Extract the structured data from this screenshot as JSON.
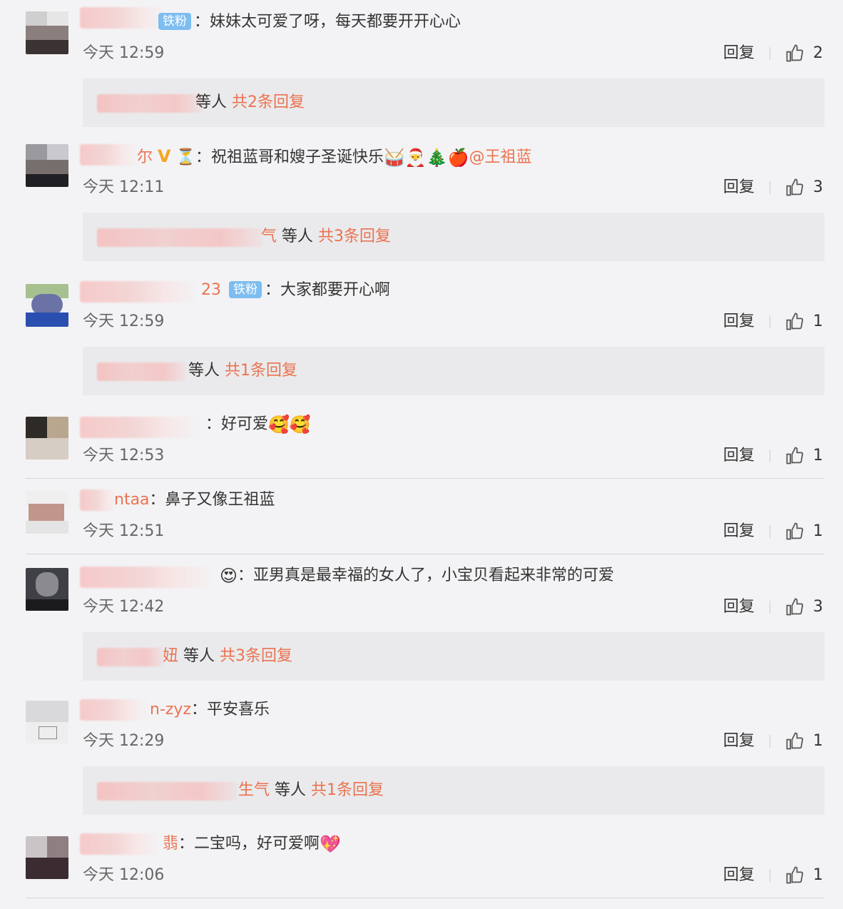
{
  "comments": [
    {
      "badge": "铁粉",
      "name_fragment": "",
      "text": "：妹妹太可爱了呀，每天都要开开心心",
      "time": "今天 12:59",
      "reply": "回复",
      "likes": "2",
      "sub": {
        "name_fragment": "等",
        "others": "人",
        "count": "共2条回复"
      }
    },
    {
      "badge": "",
      "name_fragment": "尔",
      "text": "：祝祖蓝哥和嫂子圣诞快乐",
      "mention": "@王祖蓝",
      "time": "今天 12:11",
      "reply": "回复",
      "likes": "3",
      "emojis": [
        "🥁",
        "🎅",
        "🎄",
        "🍎"
      ],
      "sub": {
        "name_fragment": "气",
        "others": "等人",
        "count": "共3条回复"
      }
    },
    {
      "badge": "铁粉",
      "name_fragment": "23",
      "text": "：大家都要开心啊",
      "time": "今天 12:59",
      "reply": "回复",
      "likes": "1",
      "sub": {
        "name_fragment": "",
        "others": "等人",
        "count": "共1条回复"
      }
    },
    {
      "badge": "",
      "name_fragment": "",
      "text": "：好可爱",
      "time": "今天 12:53",
      "reply": "回复",
      "likes": "1",
      "emojis": [
        "🥰",
        "🥰"
      ]
    },
    {
      "badge": "",
      "name_fragment": "ntaa",
      "text": "：鼻子又像王祖蓝",
      "time": "今天 12:51",
      "reply": "回复",
      "likes": "1"
    },
    {
      "badge": "",
      "name_fragment": "",
      "text": "：亚男真是最幸福的女人了，小宝贝看起来非常的可爱",
      "time": "今天 12:42",
      "reply": "回复",
      "likes": "3",
      "emojis": [
        "😍"
      ],
      "sub": {
        "name_fragment": "妞",
        "others": "等人",
        "count": "共3条回复"
      }
    },
    {
      "badge": "",
      "name_fragment": "n-zyz",
      "text": "：平安喜乐",
      "time": "今天 12:29",
      "reply": "回复",
      "likes": "1",
      "sub": {
        "name_fragment": "生气",
        "others": "等人",
        "count": "共1条回复"
      }
    },
    {
      "badge": "",
      "name_fragment": "翡",
      "text": "：二宝吗，好可爱啊",
      "time": "今天 12:06",
      "reply": "回复",
      "likes": "1",
      "emojis": [
        "💖"
      ]
    }
  ]
}
